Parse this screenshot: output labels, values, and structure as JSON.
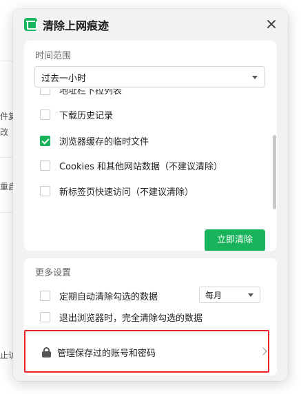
{
  "background": {
    "fragments": [
      "件复",
      "改",
      "重启",
      "止访"
    ]
  },
  "dialog": {
    "title": "清除上网痕迹",
    "icons": {
      "app": "clean-app-icon",
      "close": "close-icon"
    },
    "time_range": {
      "label": "时间范围",
      "selected": "过去一小时"
    },
    "items": [
      {
        "label": "地址栏下拉列表",
        "checked": false
      },
      {
        "label": "下载历史记录",
        "checked": false
      },
      {
        "label": "浏览器缓存的临时文件",
        "checked": true
      },
      {
        "label": "Cookies 和其他网站数据（不建议清除）",
        "checked": false
      },
      {
        "label": "新标签页快速访问（不建议清除）",
        "checked": false
      }
    ],
    "clean_button": "立即清除",
    "more_settings": {
      "label": "更多设置",
      "auto_clean": {
        "label": "定期自动清除勾选的数据",
        "checked": false,
        "frequency": "每月"
      },
      "exit_clean": {
        "label": "退出浏览器时，完全清除勾选的数据",
        "checked": false
      }
    },
    "manage_passwords": "管理保存过的账号和密码"
  },
  "colors": {
    "accent": "#19b35b",
    "highlight": "#e5252a"
  }
}
